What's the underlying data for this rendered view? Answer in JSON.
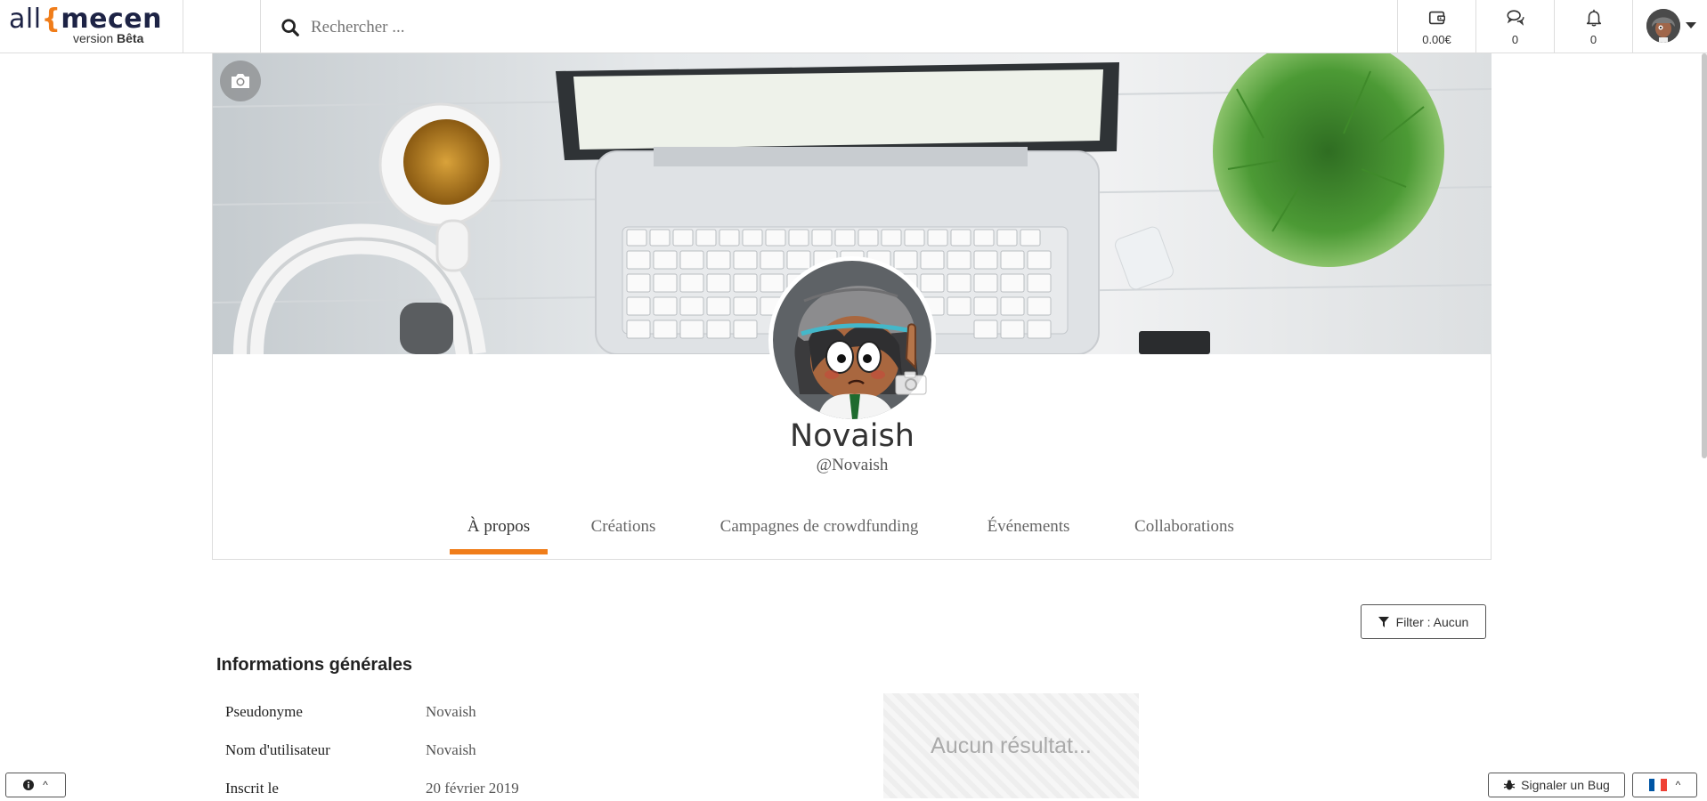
{
  "header": {
    "logo_text_all": "all",
    "logo_brace": "{",
    "logo_text_mecen": "mecen",
    "logo_version": "version ",
    "logo_beta": "Bêta",
    "search_placeholder": "Rechercher ...",
    "wallet_value": "0.00€",
    "messages_count": "0",
    "notifications_count": "0"
  },
  "profile": {
    "display_name": "Novaish",
    "handle": "@Novaish"
  },
  "tabs": [
    {
      "label": "À propos",
      "active": true
    },
    {
      "label": "Créations",
      "active": false
    },
    {
      "label": "Campagnes de crowdfunding",
      "active": false
    },
    {
      "label": "Événements",
      "active": false
    },
    {
      "label": "Collaborations",
      "active": false
    }
  ],
  "filter": {
    "label": "Filter : Aucun"
  },
  "general_info": {
    "title": "Informations générales",
    "rows": [
      {
        "key": "Pseudonyme",
        "value": "Novaish"
      },
      {
        "key": "Nom d'utilisateur",
        "value": "Novaish"
      },
      {
        "key": "Inscrit le",
        "value": "20 février 2019"
      }
    ]
  },
  "empty_state": "Aucun résultat...",
  "footer": {
    "bug_label": "Signaler un Bug"
  },
  "colors": {
    "accent": "#f07d1a",
    "brand_dark": "#1d2345"
  }
}
